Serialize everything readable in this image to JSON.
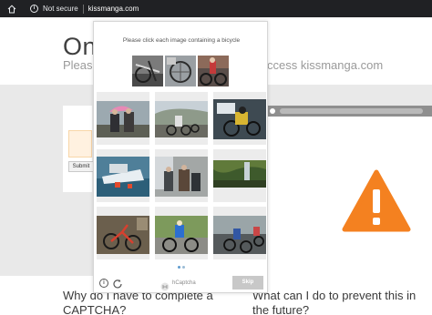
{
  "browser": {
    "security_label": "Not secure",
    "url": "kissmanga.com"
  },
  "page": {
    "title": "On",
    "subtitle_left": "Please",
    "subtitle_right": "ccess kissmanga.com",
    "submit_label": "Submit",
    "faq_left": "Why do I have to complete a CAPTCHA?",
    "faq_right": "What can I do to prevent this in the future?"
  },
  "captcha": {
    "prompt": "Please click each image containing a bicycle",
    "brand": "hCaptcha",
    "skip_label": "Skip",
    "info_icon": "info-icon",
    "refresh_icon": "refresh-icon",
    "pages": 2,
    "current_page": 1,
    "example_images": [
      "bicycle-close-up",
      "bicycle-parts",
      "cyclist-racing"
    ],
    "tiles": [
      "people-with-umbrella",
      "cyclists-on-road",
      "motorcycle-rider",
      "boat-in-water",
      "people-on-street",
      "forest-waterfall",
      "bicycle-on-ground",
      "cyclist-on-track",
      "cyclists-racing"
    ]
  },
  "colors": {
    "warning": "#f48120",
    "address_bar": "#202124",
    "skip_button": "#c8c8c8"
  }
}
